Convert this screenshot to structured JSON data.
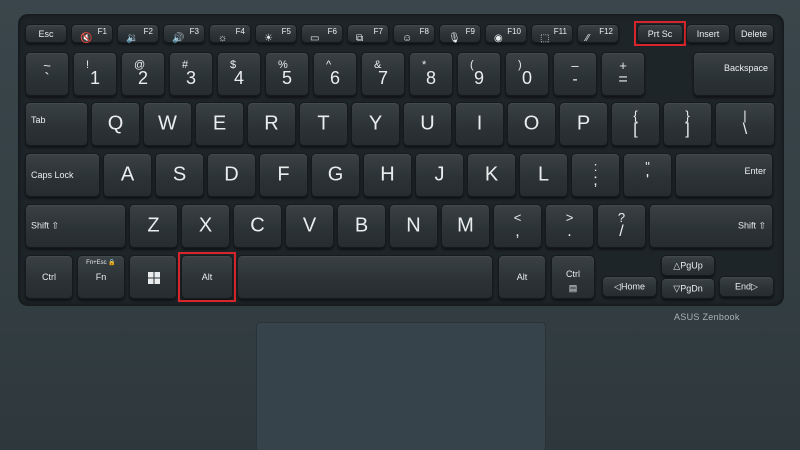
{
  "brand": "ASUS Zenbook",
  "highlight_color": "#d6262b",
  "rows": {
    "function": [
      {
        "name": "esc",
        "label": "Esc"
      },
      {
        "name": "f1",
        "fn": "F1",
        "icon": "mute-icon",
        "glyph": "🔇"
      },
      {
        "name": "f2",
        "fn": "F2",
        "icon": "volume-down-icon",
        "glyph": "🔉"
      },
      {
        "name": "f3",
        "fn": "F3",
        "icon": "volume-up-icon",
        "glyph": "🔊"
      },
      {
        "name": "f4",
        "fn": "F4",
        "icon": "brightness-down-icon",
        "glyph": "☼"
      },
      {
        "name": "f5",
        "fn": "F5",
        "icon": "brightness-up-icon",
        "glyph": "☀"
      },
      {
        "name": "f6",
        "fn": "F6",
        "icon": "touchpad-toggle-icon",
        "glyph": "▭"
      },
      {
        "name": "f7",
        "fn": "F7",
        "icon": "display-switch-icon",
        "glyph": "⧉"
      },
      {
        "name": "f8",
        "fn": "F8",
        "icon": "emoji-icon",
        "glyph": "☺"
      },
      {
        "name": "f9",
        "fn": "F9",
        "icon": "microphone-icon",
        "glyph": "🎙"
      },
      {
        "name": "f10",
        "fn": "F10",
        "icon": "camera-icon",
        "glyph": "◉"
      },
      {
        "name": "f11",
        "fn": "F11",
        "icon": "screenshot-icon",
        "glyph": "⬚"
      },
      {
        "name": "f12",
        "fn": "F12",
        "icon": "myasus-icon",
        "glyph": "⁄⁄"
      },
      {
        "name": "prtsc",
        "label": "Prt Sc"
      },
      {
        "name": "insert",
        "label": "Insert"
      },
      {
        "name": "delete",
        "label": "Delete"
      }
    ],
    "number": [
      {
        "name": "backtick",
        "top": "~",
        "bot": "`"
      },
      {
        "name": "1",
        "top": "!",
        "bot": "1"
      },
      {
        "name": "2",
        "top": "@",
        "bot": "2"
      },
      {
        "name": "3",
        "top": "#",
        "bot": "3"
      },
      {
        "name": "4",
        "top": "$",
        "bot": "4"
      },
      {
        "name": "5",
        "top": "%",
        "bot": "5"
      },
      {
        "name": "6",
        "top": "^",
        "bot": "6"
      },
      {
        "name": "7",
        "top": "&",
        "bot": "7"
      },
      {
        "name": "8",
        "top": "*",
        "bot": "8"
      },
      {
        "name": "9",
        "top": "(",
        "bot": "9"
      },
      {
        "name": "0",
        "top": ")",
        "bot": "0"
      },
      {
        "name": "minus",
        "top": "–",
        "bot": "-"
      },
      {
        "name": "equals",
        "top": "+",
        "bot": "="
      },
      {
        "name": "backspace",
        "label": "Backspace"
      }
    ],
    "qwerty": [
      {
        "name": "tab",
        "label": "Tab"
      },
      {
        "name": "q",
        "label": "Q"
      },
      {
        "name": "w",
        "label": "W"
      },
      {
        "name": "e",
        "label": "E"
      },
      {
        "name": "r",
        "label": "R"
      },
      {
        "name": "t",
        "label": "T"
      },
      {
        "name": "y",
        "label": "Y"
      },
      {
        "name": "u",
        "label": "U"
      },
      {
        "name": "i",
        "label": "I"
      },
      {
        "name": "o",
        "label": "O"
      },
      {
        "name": "p",
        "label": "P"
      },
      {
        "name": "bracket-left",
        "top": "{",
        "bot": "["
      },
      {
        "name": "bracket-right",
        "top": "}",
        "bot": "]"
      },
      {
        "name": "backslash",
        "top": "|",
        "bot": "\\"
      }
    ],
    "home": [
      {
        "name": "capslock",
        "label": "Caps Lock"
      },
      {
        "name": "a",
        "label": "A"
      },
      {
        "name": "s",
        "label": "S"
      },
      {
        "name": "d",
        "label": "D"
      },
      {
        "name": "f",
        "label": "F"
      },
      {
        "name": "g",
        "label": "G"
      },
      {
        "name": "h",
        "label": "H"
      },
      {
        "name": "j",
        "label": "J"
      },
      {
        "name": "k",
        "label": "K"
      },
      {
        "name": "l",
        "label": "L"
      },
      {
        "name": "semicolon",
        "top": ":",
        "bot": ";"
      },
      {
        "name": "quote",
        "top": "\"",
        "bot": "'"
      },
      {
        "name": "enter",
        "label": "Enter"
      }
    ],
    "shift": [
      {
        "name": "shift-left",
        "label": "Shift ⇧"
      },
      {
        "name": "z",
        "label": "Z"
      },
      {
        "name": "x",
        "label": "X"
      },
      {
        "name": "c",
        "label": "C"
      },
      {
        "name": "v",
        "label": "V"
      },
      {
        "name": "b",
        "label": "B"
      },
      {
        "name": "n",
        "label": "N"
      },
      {
        "name": "m",
        "label": "M"
      },
      {
        "name": "comma",
        "top": "<",
        "bot": ","
      },
      {
        "name": "period",
        "top": ">",
        "bot": "."
      },
      {
        "name": "slash",
        "top": "?",
        "bot": "/"
      },
      {
        "name": "shift-right",
        "label": "Shift ⇧"
      }
    ],
    "bottom": [
      {
        "name": "ctrl-left",
        "label": "Ctrl"
      },
      {
        "name": "fn",
        "label": "Fn",
        "sub": "Fn+Esc 🔒"
      },
      {
        "name": "windows",
        "icon": "windows-icon"
      },
      {
        "name": "alt-left",
        "label": "Alt"
      },
      {
        "name": "space",
        "label": ""
      },
      {
        "name": "alt-right",
        "label": "Alt"
      },
      {
        "name": "ctrl-right",
        "label": "Ctrl",
        "sub": "▤"
      },
      {
        "name": "home",
        "label": "◁Home"
      },
      {
        "name": "pgup",
        "label": "△PgUp"
      },
      {
        "name": "pgdn",
        "label": "▽PgDn"
      },
      {
        "name": "end",
        "label": "End▷"
      }
    ]
  }
}
